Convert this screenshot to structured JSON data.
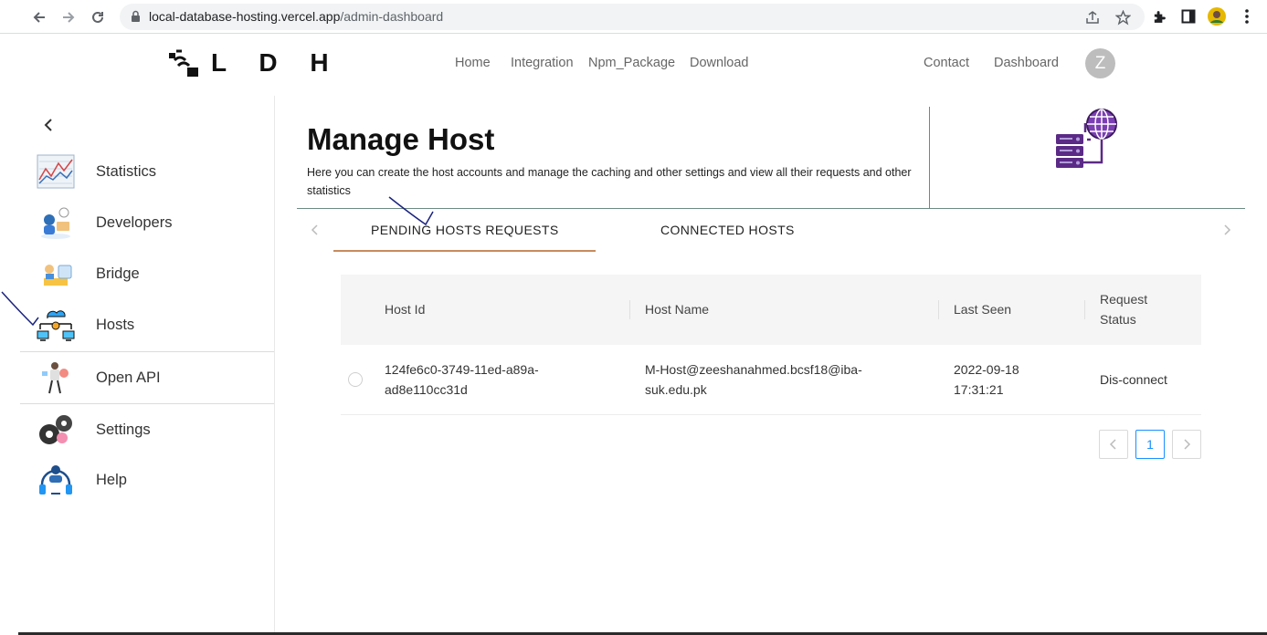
{
  "browser": {
    "url_host": "local-database-hosting.vercel.app",
    "url_path": "/admin-dashboard",
    "icons": [
      "back-arrow-icon",
      "forward-arrow-icon",
      "reload-icon",
      "lock-icon",
      "share-icon",
      "star-icon",
      "extensions-icon",
      "side-panel-icon",
      "profile-avatar-icon",
      "menu-dots-icon"
    ]
  },
  "header": {
    "logo_text": "L D H",
    "nav": [
      "Home",
      "Integration",
      "Npm_Package",
      "Download"
    ],
    "right_nav": [
      "Contact",
      "Dashboard"
    ],
    "avatar_letter": "Z"
  },
  "sidebar": {
    "items": [
      {
        "label": "Statistics",
        "icon": "statistics-chart-icon"
      },
      {
        "label": "Developers",
        "icon": "developers-icon"
      },
      {
        "label": "Bridge",
        "icon": "bridge-icon"
      },
      {
        "label": "Hosts",
        "icon": "hosts-network-icon"
      },
      {
        "label": "Open API",
        "icon": "open-api-icon"
      },
      {
        "label": "Settings",
        "icon": "settings-gears-icon"
      },
      {
        "label": "Help",
        "icon": "help-headset-icon"
      }
    ]
  },
  "main": {
    "title": "Manage Host",
    "description": "Here you can create the host accounts and manage the caching and other settings and view all their requests and other statistics",
    "tabs": [
      "PENDING HOSTS REQUESTS",
      "CONNECTED HOSTS"
    ],
    "active_tab": 0,
    "table": {
      "columns": [
        "Host Id",
        "Host Name",
        "Last Seen",
        "Request Status"
      ],
      "rows": [
        {
          "host_id": "124fe6c0-3749-11ed-a89a-ad8e110cc31d",
          "host_name": "M-Host@zeeshanahmed.bcsf18@iba-suk.edu.pk",
          "last_seen": "2022-09-18 17:31:21",
          "status": "Dis-connect"
        }
      ]
    },
    "pagination": {
      "current_page": "1"
    }
  },
  "colors": {
    "tab_ink": "#c98b5e",
    "pagination_active": "#1890ff",
    "hero_icon_purple": "#5b2a86",
    "annotation_ink": "#1a237e"
  }
}
